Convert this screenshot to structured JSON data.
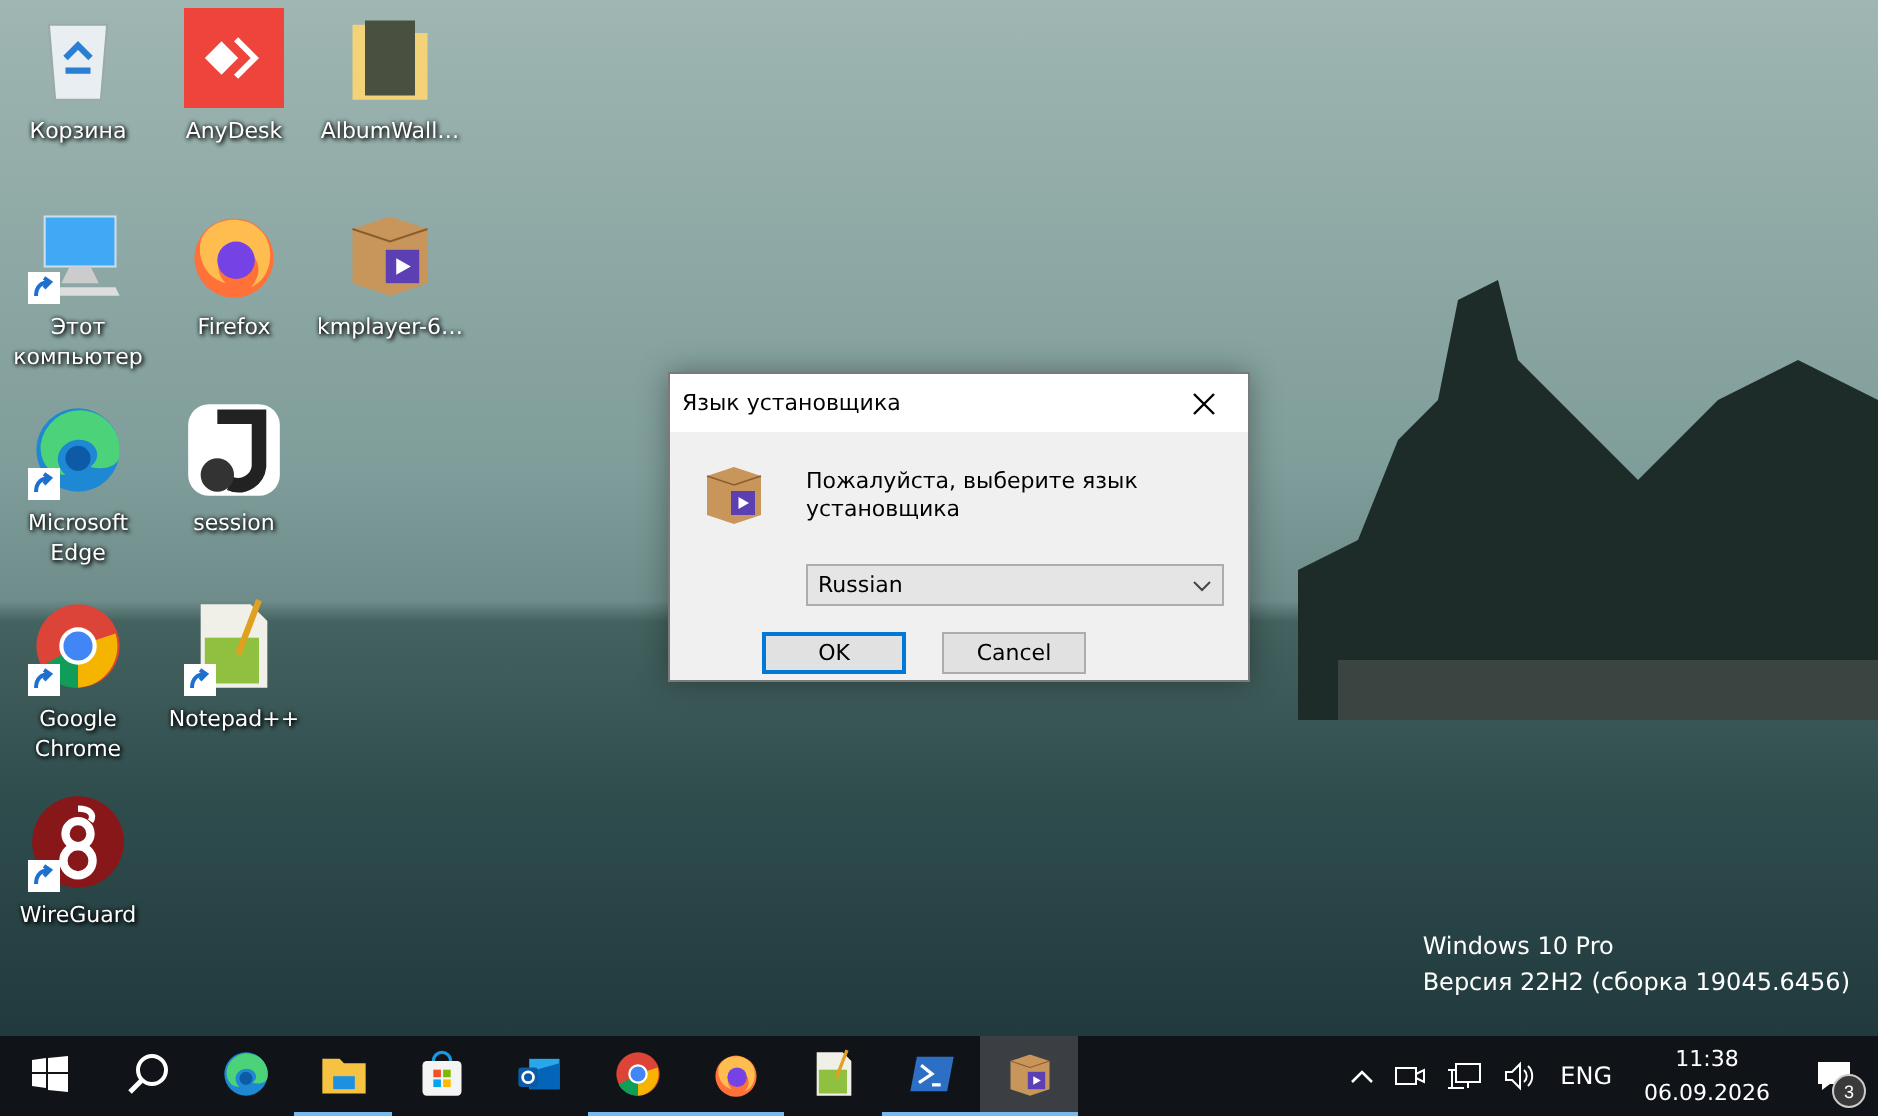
{
  "desktop": {
    "columns": [
      [
        {
          "label": "Корзина",
          "kind": "recycle",
          "shortcut": false
        },
        {
          "label": "Этот компьютер",
          "kind": "computer",
          "shortcut": true
        },
        {
          "label": "Microsoft Edge",
          "kind": "edge",
          "shortcut": true
        },
        {
          "label": "Google Chrome",
          "kind": "chrome",
          "shortcut": true
        },
        {
          "label": "WireGuard",
          "kind": "wireguard",
          "shortcut": true
        }
      ],
      [
        {
          "label": "AnyDesk",
          "kind": "anydesk",
          "shortcut": false
        },
        {
          "label": "Firefox",
          "kind": "firefox",
          "shortcut": false
        },
        {
          "label": "session",
          "kind": "session",
          "shortcut": false
        },
        {
          "label": "Notepad++",
          "kind": "notepad",
          "shortcut": true
        }
      ],
      [
        {
          "label": "AlbumWall…",
          "kind": "folder",
          "shortcut": false
        },
        {
          "label": "kmplayer-6…",
          "kind": "installer",
          "shortcut": false
        }
      ]
    ]
  },
  "os_info": [
    "Windows 10 Pro",
    "Версия 22H2 (сборка 19045.6456)"
  ],
  "dialog": {
    "title": "Язык установщика",
    "message": "Пожалуйста, выберите язык установщика",
    "language": "Russian",
    "buttons": [
      {
        "label": "OK",
        "selected": true
      },
      {
        "label": "Cancel",
        "selected": false
      }
    ]
  },
  "taskbar": {
    "apps": [
      {
        "kind": "start",
        "running": false,
        "selected": false
      },
      {
        "kind": "search",
        "running": false,
        "selected": false
      },
      {
        "kind": "edge",
        "running": false,
        "selected": false
      },
      {
        "kind": "explorer",
        "running": true,
        "selected": false
      },
      {
        "kind": "store",
        "running": false,
        "selected": false
      },
      {
        "kind": "outlook",
        "running": false,
        "selected": false
      },
      {
        "kind": "chrome",
        "running": true,
        "selected": false
      },
      {
        "kind": "firefox",
        "running": true,
        "selected": false
      },
      {
        "kind": "notepad",
        "running": false,
        "selected": false
      },
      {
        "kind": "powershell",
        "running": true,
        "selected": false
      },
      {
        "kind": "installer",
        "running": true,
        "selected": true
      }
    ],
    "tray": {
      "language": "ENG",
      "time": "11:38",
      "date": "06.09.2026",
      "notifications": "3"
    }
  }
}
